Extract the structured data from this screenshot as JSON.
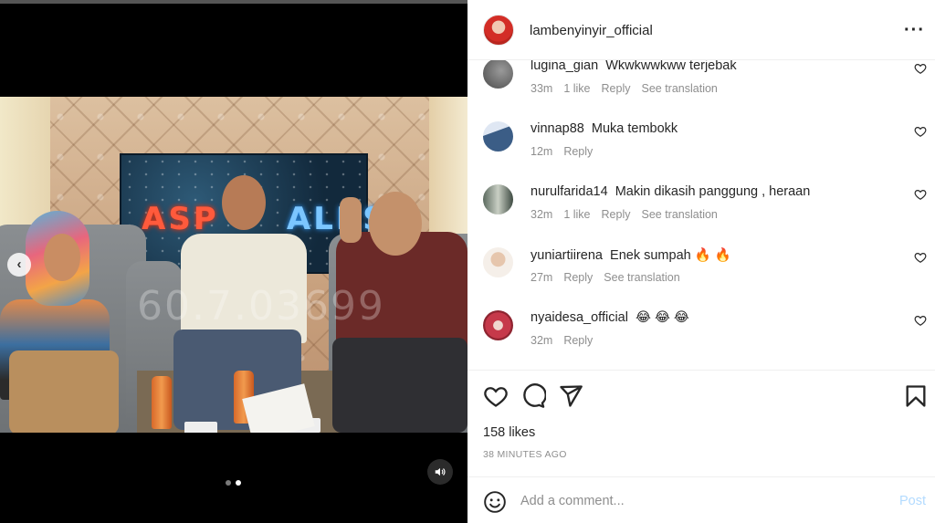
{
  "post": {
    "username": "lambenyinyir_official",
    "more_icon": "more-horizontal-icon",
    "likes": "158 likes",
    "time_ago": "38 MINUTES AGO"
  },
  "media": {
    "screen_text_a": "ASP",
    "screen_text_b": "ALKS",
    "watermark": "60.7.03699",
    "carousel": {
      "current": 2,
      "total": 2
    },
    "prev_icon": "chevron-left-icon",
    "mute_icon": "speaker-icon"
  },
  "comments": [
    {
      "user": "lugina_gian",
      "text": "Wkwkwwkww terjebak",
      "time": "33m",
      "likes": "1 like",
      "reply": "Reply",
      "translate": "See translation",
      "avatar_color": "#6f6f6f"
    },
    {
      "user": "vinnap88",
      "text": "Muka tembokk",
      "time": "12m",
      "likes": "",
      "reply": "Reply",
      "translate": "",
      "avatar_color": "#3f5f8f"
    },
    {
      "user": "nurulfarida14",
      "text": "Makin dikasih panggung , heraan",
      "time": "32m",
      "likes": "1 like",
      "reply": "Reply",
      "translate": "See translation",
      "avatar_color": "#4d5a52"
    },
    {
      "user": "yuniartiirena",
      "text": "Enek sumpah 🔥 🔥",
      "time": "27m",
      "likes": "",
      "reply": "Reply",
      "translate": "See translation",
      "avatar_color": "#c9a48a"
    },
    {
      "user": "nyaidesa_official",
      "text": "😂 😂 😂",
      "time": "32m",
      "likes": "",
      "reply": "Reply",
      "translate": "",
      "avatar_color": "#c6394a"
    }
  ],
  "composer": {
    "placeholder": "Add a comment...",
    "post_label": "Post",
    "post_color": "#b3dbff"
  },
  "icons": {
    "like": "heart-icon",
    "comment": "comment-icon",
    "share": "send-icon",
    "save": "bookmark-icon",
    "emoji": "smiley-icon"
  }
}
